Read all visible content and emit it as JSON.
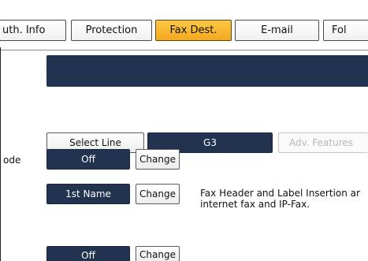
{
  "tabs": [
    {
      "label": "uth. Info",
      "active": false
    },
    {
      "label": "Protection",
      "active": false
    },
    {
      "label": "Fax Dest.",
      "active": true
    },
    {
      "label": "E-mail",
      "active": false
    },
    {
      "label": "Fol",
      "active": false
    }
  ],
  "line": {
    "select_line_label": "Select Line",
    "value": "G3",
    "adv_features_label": "Adv. Features"
  },
  "settings": [
    {
      "label": "ode",
      "value": "Off",
      "change_label": "Change"
    },
    {
      "label": "",
      "value": "1st Name",
      "change_label": "Change"
    },
    {
      "label": "",
      "value": "Off",
      "change_label": "Change"
    }
  ],
  "note_lines": [
    "Fax Header and Label Insertion ar",
    "internet fax and IP-Fax."
  ],
  "colors": {
    "active_tab": "#f3a81d",
    "dark_fill": "#223350"
  }
}
